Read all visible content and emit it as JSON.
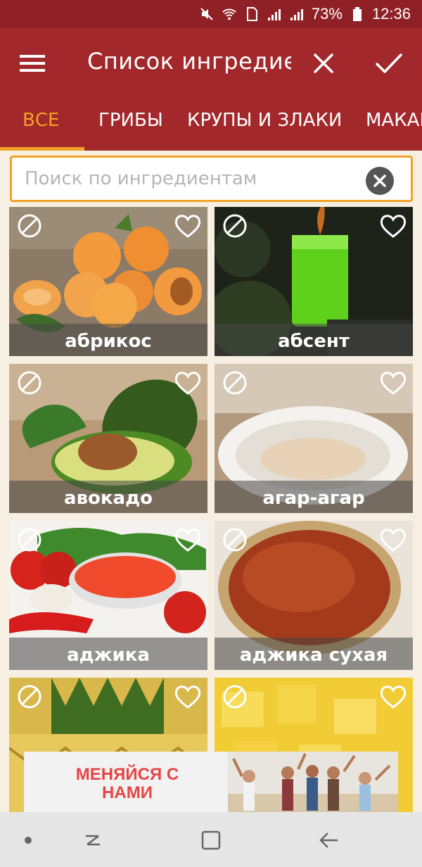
{
  "status": {
    "battery_text": "73%",
    "time": "12:36"
  },
  "toolbar": {
    "title": "Список ингредиен"
  },
  "tabs": [
    {
      "label": "ВСЕ"
    },
    {
      "label": "ГРИБЫ"
    },
    {
      "label": "КРУПЫ И ЗЛАКИ"
    },
    {
      "label": "МАКАРОНЫ"
    }
  ],
  "search": {
    "placeholder": "Поиск по ингредиентам",
    "value": ""
  },
  "ingredients": [
    {
      "label": "абрикос"
    },
    {
      "label": "абсент"
    },
    {
      "label": "авокадо"
    },
    {
      "label": "агар-агар"
    },
    {
      "label": "аджика"
    },
    {
      "label": "аджика сухая"
    },
    {
      "label": ""
    },
    {
      "label": ""
    }
  ],
  "ad": {
    "text": "МЕНЯЙСЯ С НАМИ"
  },
  "colors": {
    "primary": "#a3282b",
    "accent": "#f3a227",
    "background": "#f7efe2"
  }
}
